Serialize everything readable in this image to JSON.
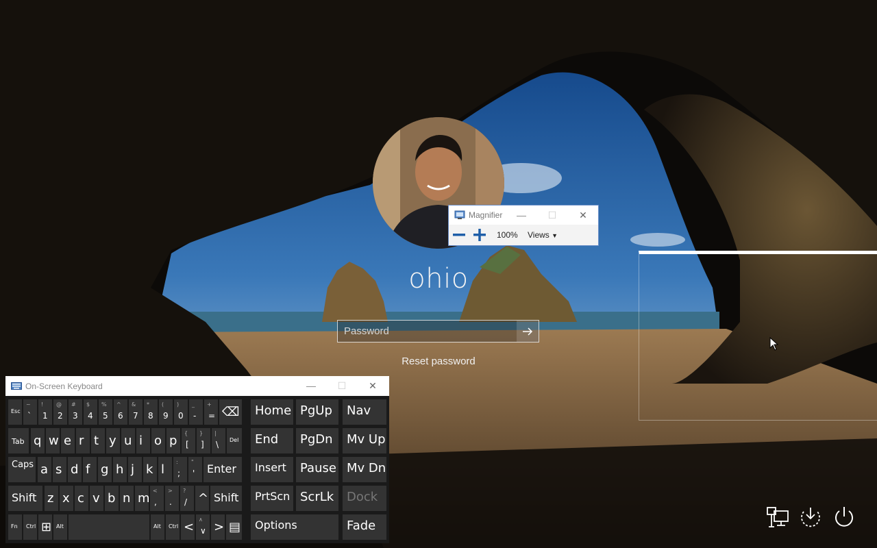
{
  "lock_screen": {
    "username": "ohio",
    "password_placeholder": "Password",
    "reset_password_label": "Reset password"
  },
  "magnifier": {
    "title": "Magnifier",
    "zoom_level": "100%",
    "views_label": "Views"
  },
  "osk": {
    "title": "On-Screen Keyboard",
    "rows": [
      [
        {
          "main": "Esc",
          "shift": ""
        },
        {
          "main": "`",
          "shift": "~"
        },
        {
          "main": "1",
          "shift": "!"
        },
        {
          "main": "2",
          "shift": "@"
        },
        {
          "main": "3",
          "shift": "#"
        },
        {
          "main": "4",
          "shift": "$"
        },
        {
          "main": "5",
          "shift": "%"
        },
        {
          "main": "6",
          "shift": "^"
        },
        {
          "main": "7",
          "shift": "&"
        },
        {
          "main": "8",
          "shift": "*"
        },
        {
          "main": "9",
          "shift": "("
        },
        {
          "main": "0",
          "shift": ")"
        },
        {
          "main": "-",
          "shift": "_"
        },
        {
          "main": "=",
          "shift": "+"
        },
        {
          "main": "⌫",
          "shift": ""
        }
      ],
      [
        {
          "main": "Tab",
          "shift": ""
        },
        {
          "main": "q",
          "shift": ""
        },
        {
          "main": "w",
          "shift": ""
        },
        {
          "main": "e",
          "shift": ""
        },
        {
          "main": "r",
          "shift": ""
        },
        {
          "main": "t",
          "shift": ""
        },
        {
          "main": "y",
          "shift": ""
        },
        {
          "main": "u",
          "shift": ""
        },
        {
          "main": "i",
          "shift": ""
        },
        {
          "main": "o",
          "shift": ""
        },
        {
          "main": "p",
          "shift": ""
        },
        {
          "main": "[",
          "shift": "{"
        },
        {
          "main": "]",
          "shift": "}"
        },
        {
          "main": "\\",
          "shift": "|"
        },
        {
          "main": "Del",
          "shift": ""
        }
      ],
      [
        {
          "main": "Caps",
          "shift": ""
        },
        {
          "main": "a",
          "shift": ""
        },
        {
          "main": "s",
          "shift": ""
        },
        {
          "main": "d",
          "shift": ""
        },
        {
          "main": "f",
          "shift": ""
        },
        {
          "main": "g",
          "shift": ""
        },
        {
          "main": "h",
          "shift": ""
        },
        {
          "main": "j",
          "shift": ""
        },
        {
          "main": "k",
          "shift": ""
        },
        {
          "main": "l",
          "shift": ""
        },
        {
          "main": ";",
          "shift": ":"
        },
        {
          "main": "'",
          "shift": "\""
        },
        {
          "main": "Enter",
          "shift": ""
        }
      ],
      [
        {
          "main": "Shift",
          "shift": ""
        },
        {
          "main": "z",
          "shift": ""
        },
        {
          "main": "x",
          "shift": ""
        },
        {
          "main": "c",
          "shift": ""
        },
        {
          "main": "v",
          "shift": ""
        },
        {
          "main": "b",
          "shift": ""
        },
        {
          "main": "n",
          "shift": ""
        },
        {
          "main": "m",
          "shift": ""
        },
        {
          "main": ",",
          "shift": "<"
        },
        {
          "main": ".",
          "shift": ">"
        },
        {
          "main": "/",
          "shift": "?"
        },
        {
          "main": "^",
          "shift": ""
        },
        {
          "main": "Shift",
          "shift": ""
        }
      ],
      [
        {
          "main": "Fn",
          "shift": ""
        },
        {
          "main": "Ctrl",
          "shift": ""
        },
        {
          "main": "⊞",
          "shift": ""
        },
        {
          "main": "Alt",
          "shift": ""
        },
        {
          "main": "",
          "shift": ""
        },
        {
          "main": "Alt",
          "shift": ""
        },
        {
          "main": "Ctrl",
          "shift": ""
        },
        {
          "main": "<",
          "shift": ""
        },
        {
          "main": "∨",
          "shift": "∧"
        },
        {
          "main": ">",
          "shift": ""
        },
        {
          "main": "▤",
          "shift": ""
        }
      ]
    ],
    "nav_keys": [
      [
        "Home",
        "PgUp",
        "Nav"
      ],
      [
        "End",
        "PgDn",
        "Mv Up"
      ],
      [
        "Insert",
        "Pause",
        "Mv Dn"
      ],
      [
        "PrtScn",
        "ScrLk",
        "Dock"
      ],
      [
        "Options",
        "Fade"
      ]
    ]
  },
  "icons": {
    "network": "network-icon",
    "ease_of_access": "ease-of-access-icon",
    "power": "power-icon"
  }
}
